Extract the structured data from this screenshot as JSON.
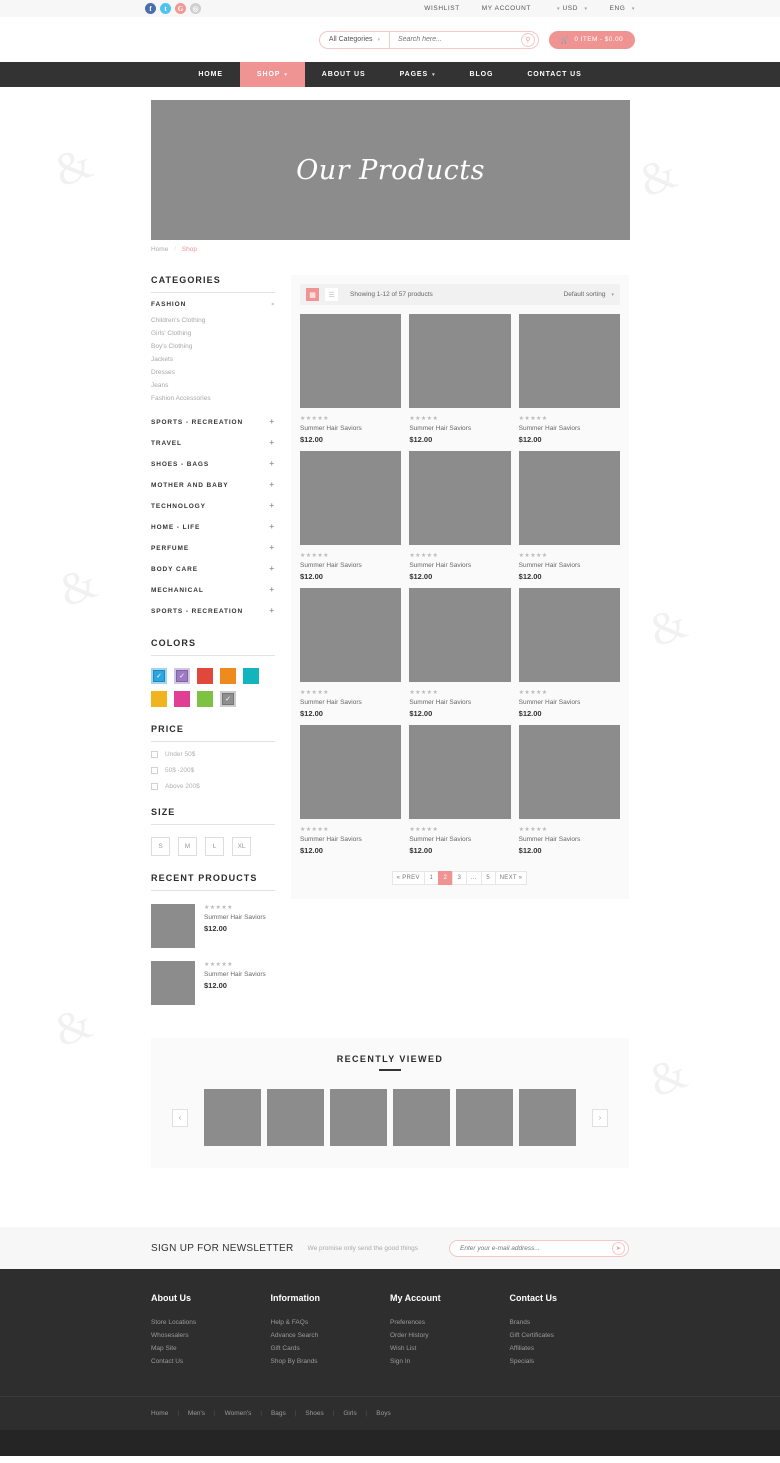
{
  "topbar": {
    "social": [
      {
        "name": "facebook-icon",
        "glyph": "f",
        "cls": "fb"
      },
      {
        "name": "twitter-icon",
        "glyph": "t",
        "cls": "tw"
      },
      {
        "name": "google-plus-icon",
        "glyph": "G",
        "cls": "gp"
      },
      {
        "name": "instagram-icon",
        "glyph": "◎",
        "cls": "ig"
      }
    ],
    "links": [
      "WISHLIST",
      "MY ACCOUNT"
    ],
    "currency": "USD",
    "language": "ENG"
  },
  "header": {
    "category_select": "All Categories",
    "search_placeholder": "Search here...",
    "search_icon": "search-icon",
    "cart_label": "0 ITEM - $0.00",
    "cart_icon": "cart-icon",
    "accent": "#f09393"
  },
  "nav": {
    "items": [
      {
        "label": "HOME",
        "active": false,
        "caret": false
      },
      {
        "label": "SHOP",
        "active": true,
        "caret": true
      },
      {
        "label": "ABOUT US",
        "active": false,
        "caret": false
      },
      {
        "label": "PAGES",
        "active": false,
        "caret": true
      },
      {
        "label": "BLOG",
        "active": false,
        "caret": false
      },
      {
        "label": "CONTACT US",
        "active": false,
        "caret": false
      }
    ]
  },
  "banner": {
    "title": "Our Products"
  },
  "breadcrumb": {
    "home": "Home",
    "separator": "/",
    "current": "Shop"
  },
  "sidebar": {
    "categories_title": "CATEGORIES",
    "fashion": {
      "label": "FASHION",
      "sign": "-"
    },
    "subcategories": [
      "Children's Clothing",
      "Girls' Clothing",
      "Boy's Clothing",
      "Jackets",
      "Dresses",
      "Jeans",
      "Fashion Accessories"
    ],
    "categories": [
      {
        "label": "SPORTS - RECREATION",
        "sign": "+"
      },
      {
        "label": "TRAVEL",
        "sign": "+"
      },
      {
        "label": "SHOES - BAGS",
        "sign": "+"
      },
      {
        "label": "MOTHER AND BABY",
        "sign": "+"
      },
      {
        "label": "TECHNOLOGY",
        "sign": "+"
      },
      {
        "label": "HOME - LIFE",
        "sign": "+"
      },
      {
        "label": "PERFUME",
        "sign": "+"
      },
      {
        "label": "BODY CARE",
        "sign": "+"
      },
      {
        "label": "MECHANICAL",
        "sign": "+"
      },
      {
        "label": "SPORTS - RECREATION",
        "sign": "+"
      }
    ],
    "colors_title": "COLORS",
    "colors": [
      {
        "hex": "#2ba6e0",
        "checked": true
      },
      {
        "hex": "#9b7cc4",
        "checked": true
      },
      {
        "hex": "#e0483c",
        "checked": false
      },
      {
        "hex": "#ee8b1c",
        "checked": false
      },
      {
        "hex": "#12b5bb",
        "checked": false
      },
      {
        "hex": "#efb41e",
        "checked": false
      },
      {
        "hex": "#e03f94",
        "checked": false
      },
      {
        "hex": "#7dc242",
        "checked": false
      },
      {
        "hex": "#8f8f8f",
        "checked": true
      }
    ],
    "price_title": "PRICE",
    "prices": [
      "Under 50$",
      "50$ -200$",
      "Above 200$"
    ],
    "size_title": "SIZE",
    "sizes": [
      "S",
      "M",
      "L",
      "XL"
    ],
    "recent_title": "RECENT PRODUCTS",
    "recent_products": [
      {
        "stars": "★★★★★",
        "name": "Summer Hair Saviors",
        "price": "$12.00"
      },
      {
        "stars": "★★★★★",
        "name": "Summer Hair Saviors",
        "price": "$12.00"
      }
    ]
  },
  "toolbar": {
    "grid_icon": "grid-view-icon",
    "list_icon": "list-view-icon",
    "showing": "Showing 1-12 of 57 products",
    "sorting": "Default sorting"
  },
  "products": [
    {
      "stars": "★★★★★",
      "name": "Summer Hair Saviors",
      "price": "$12.00"
    },
    {
      "stars": "★★★★★",
      "name": "Summer Hair Saviors",
      "price": "$12.00"
    },
    {
      "stars": "★★★★★",
      "name": "Summer Hair Saviors",
      "price": "$12.00"
    },
    {
      "stars": "★★★★★",
      "name": "Summer Hair Saviors",
      "price": "$12.00"
    },
    {
      "stars": "★★★★★",
      "name": "Summer Hair Saviors",
      "price": "$12.00"
    },
    {
      "stars": "★★★★★",
      "name": "Summer Hair Saviors",
      "price": "$12.00"
    },
    {
      "stars": "★★★★★",
      "name": "Summer Hair Saviors",
      "price": "$12.00"
    },
    {
      "stars": "★★★★★",
      "name": "Summer Hair Saviors",
      "price": "$12.00"
    },
    {
      "stars": "★★★★★",
      "name": "Summer Hair Saviors",
      "price": "$12.00"
    },
    {
      "stars": "★★★★★",
      "name": "Summer Hair Saviors",
      "price": "$12.00"
    },
    {
      "stars": "★★★★★",
      "name": "Summer Hair Saviors",
      "price": "$12.00"
    },
    {
      "stars": "★★★★★",
      "name": "Summer Hair Saviors",
      "price": "$12.00"
    }
  ],
  "pagination": [
    {
      "label": "« PREV",
      "active": false
    },
    {
      "label": "1",
      "active": false
    },
    {
      "label": "2",
      "active": true
    },
    {
      "label": "3",
      "active": false
    },
    {
      "label": "...",
      "active": false
    },
    {
      "label": "5",
      "active": false
    },
    {
      "label": "NEXT »",
      "active": false
    }
  ],
  "recently_viewed": {
    "title": "RECENTLY VIEWED",
    "prev_icon": "chevron-left-icon",
    "next_icon": "chevron-right-icon",
    "count": 6
  },
  "newsletter": {
    "title": "SIGN UP FOR NEWSLETTER",
    "subtitle": "We promise only send the good things",
    "placeholder": "Enter your e-mail address...",
    "submit_icon": "send-icon"
  },
  "footer": {
    "columns": [
      {
        "title": "About Us",
        "links": [
          "Store Locations",
          "Whosesalers",
          "Map Site",
          "Contact Us"
        ]
      },
      {
        "title": "Information",
        "links": [
          "Help & FAQs",
          "Advance Search",
          "Gift Cards",
          "Shop By Brands"
        ]
      },
      {
        "title": "My Account",
        "links": [
          "Preferences",
          "Order History",
          "Wish List",
          "Sign In"
        ]
      },
      {
        "title": "Contact Us",
        "links": [
          "Brands",
          "Gift Certificates",
          "Affiliates",
          "Specials"
        ]
      }
    ],
    "bottom_links": [
      "Home",
      "Men's",
      "Women's",
      "Bags",
      "Shoes",
      "Girls",
      "Boys"
    ]
  }
}
